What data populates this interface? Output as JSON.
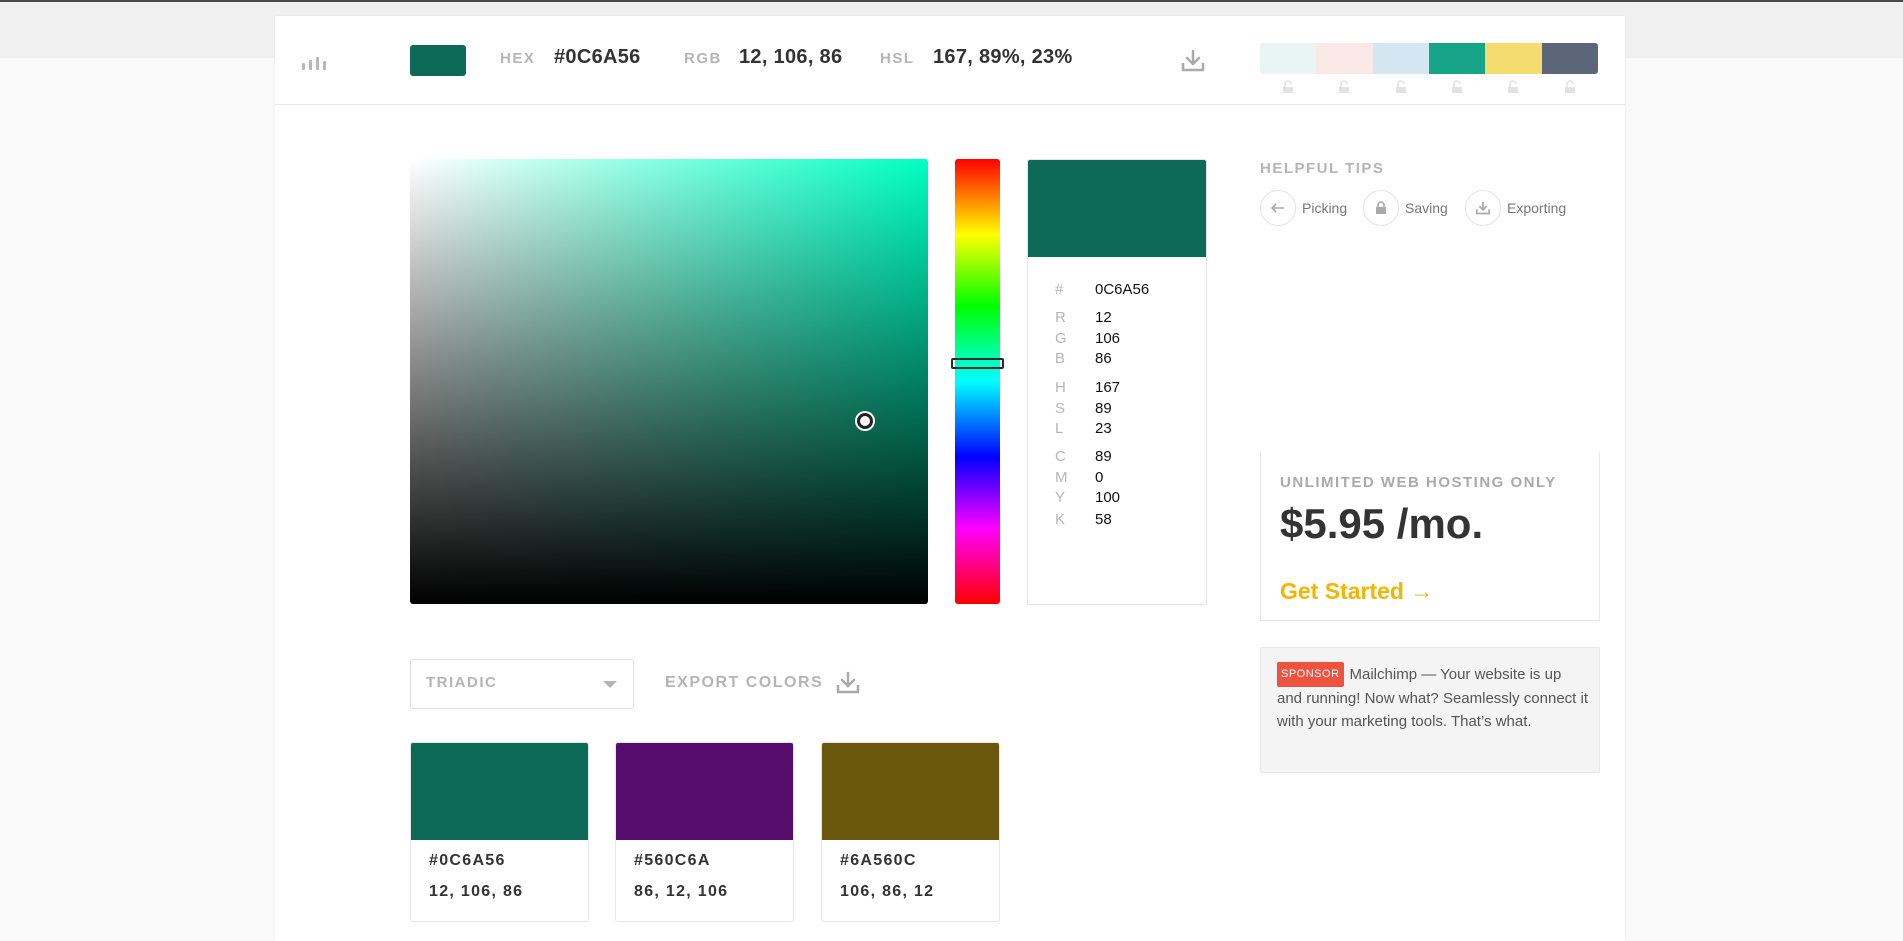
{
  "header": {
    "hex_label": "HEX",
    "hex_value": "#0C6A56",
    "rgb_label": "RGB",
    "rgb_value": "12, 106, 86",
    "hsl_label": "HSL",
    "hsl_value": "167, 89%, 23%",
    "icons": {
      "menu": "bar-chart-icon",
      "download": "download-icon",
      "lock": "lock-icon"
    }
  },
  "palette": [
    "#e8f5f2",
    "#fbe9e8",
    "#d4e6f1",
    "#17a589",
    "#f5dc6e",
    "#5b6779"
  ],
  "current_color": "#0C6A56",
  "picker": {
    "hue_top_color": "#00ffc3"
  },
  "values": [
    {
      "k": "#",
      "v": "0C6A56"
    },
    {
      "k": "R",
      "v": "12"
    },
    {
      "k": "G",
      "v": "106"
    },
    {
      "k": "B",
      "v": "86"
    },
    {
      "k": "H",
      "v": "167"
    },
    {
      "k": "S",
      "v": "89"
    },
    {
      "k": "L",
      "v": "23"
    },
    {
      "k": "C",
      "v": "89"
    },
    {
      "k": "M",
      "v": "0"
    },
    {
      "k": "Y",
      "v": "100"
    },
    {
      "k": "K",
      "v": "58"
    }
  ],
  "harmony": {
    "selected": "TRIADIC",
    "export_label": "EXPORT COLORS",
    "colors": [
      {
        "color": "#0c6a56",
        "hex": "#0C6A56",
        "rgb": "12, 106, 86"
      },
      {
        "color": "#560c6a",
        "hex": "#560C6A",
        "rgb": "86, 12, 106"
      },
      {
        "color": "#6a560c",
        "hex": "#6A560C",
        "rgb": "106, 86, 12"
      }
    ]
  },
  "tips": {
    "title": "HELPFUL TIPS",
    "items": [
      {
        "label": "Picking",
        "icon": "arrow-left-icon"
      },
      {
        "label": "Saving",
        "icon": "lock-icon"
      },
      {
        "label": "Exporting",
        "icon": "download-icon"
      }
    ]
  },
  "ad": {
    "top": "UNLIMITED WEB HOSTING ONLY",
    "price": "$5.95 /mo.",
    "cta": "Get Started →"
  },
  "sponsor": {
    "badge": "SPONSOR",
    "text": "Mailchimp — Your website is up and running! Now what? Seamlessly connect it with your marketing tools. That’s what."
  }
}
